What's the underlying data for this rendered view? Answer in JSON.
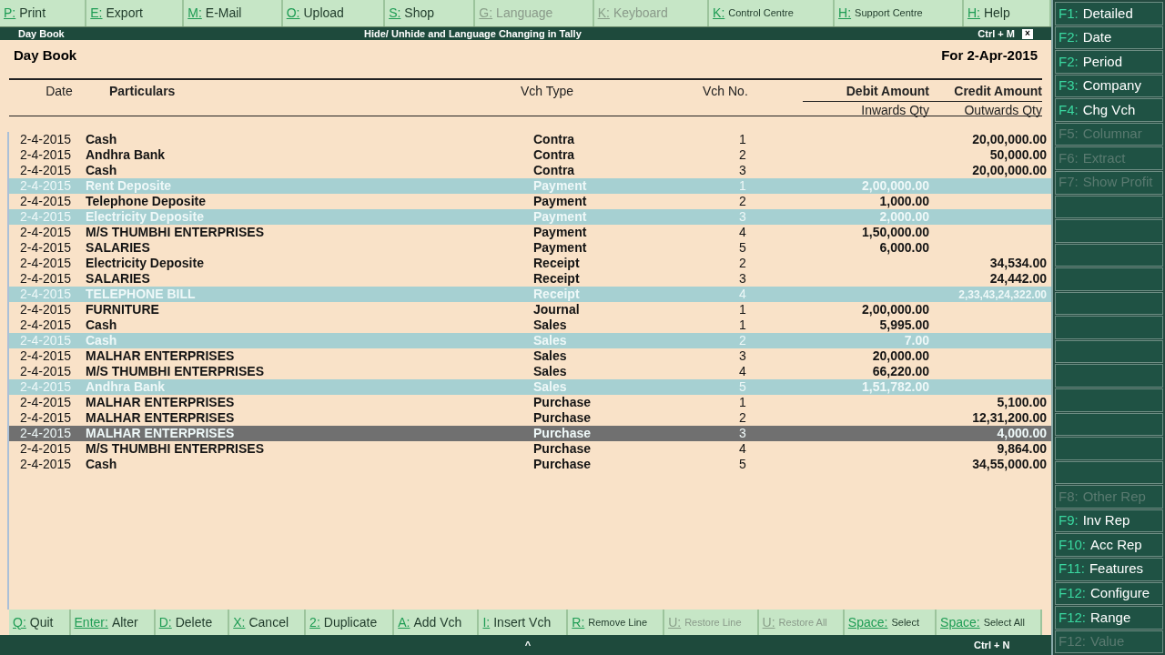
{
  "top_buttons": [
    {
      "key": "P:",
      "label": "Print",
      "disabled": false,
      "small": false
    },
    {
      "key": "E:",
      "label": "Export",
      "disabled": false,
      "small": false
    },
    {
      "key": "M:",
      "label": "E-Mail",
      "disabled": false,
      "small": false
    },
    {
      "key": "O:",
      "label": "Upload",
      "disabled": false,
      "small": false
    },
    {
      "key": "S:",
      "label": "Shop",
      "disabled": false,
      "small": false
    },
    {
      "key": "G:",
      "label": "Language",
      "disabled": true,
      "small": false
    },
    {
      "key": "K:",
      "label": "Keyboard",
      "disabled": true,
      "small": false
    },
    {
      "key": "K:",
      "label": "Control Centre",
      "disabled": false,
      "small": true
    },
    {
      "key": "H:",
      "label": "Support Centre",
      "disabled": false,
      "small": true
    },
    {
      "key": "H:",
      "label": "Help",
      "disabled": false,
      "small": false
    }
  ],
  "title_bar": {
    "left": "Day Book",
    "center": "Hide/ Unhide  and Language Changing in Tally",
    "shortcut": "Ctrl + M",
    "close": "×"
  },
  "report": {
    "title": "Day Book",
    "period": "For 2-Apr-2015"
  },
  "columns": {
    "date": "Date",
    "particulars": "Particulars",
    "vch_type": "Vch Type",
    "vch_no": "Vch No.",
    "debit": "Debit Amount",
    "credit": "Credit Amount",
    "inwards": "Inwards Qty",
    "outwards": "Outwards Qty"
  },
  "rows": [
    {
      "date": "2-4-2015",
      "particulars": "Cash",
      "vch_type": "Contra",
      "vch_no": "1",
      "debit": "",
      "credit": "20,00,000.00",
      "hidden": false,
      "selected": false
    },
    {
      "date": "2-4-2015",
      "particulars": "Andhra Bank",
      "vch_type": "Contra",
      "vch_no": "2",
      "debit": "",
      "credit": "50,000.00",
      "hidden": false,
      "selected": false
    },
    {
      "date": "2-4-2015",
      "particulars": "Cash",
      "vch_type": "Contra",
      "vch_no": "3",
      "debit": "",
      "credit": "20,00,000.00",
      "hidden": false,
      "selected": false
    },
    {
      "date": "2-4-2015",
      "particulars": "Rent Deposite",
      "vch_type": "Payment",
      "vch_no": "1",
      "debit": "2,00,000.00",
      "credit": "",
      "hidden": true,
      "selected": false
    },
    {
      "date": "2-4-2015",
      "particulars": "Telephone Deposite",
      "vch_type": "Payment",
      "vch_no": "2",
      "debit": "1,000.00",
      "credit": "",
      "hidden": false,
      "selected": false
    },
    {
      "date": "2-4-2015",
      "particulars": "Electricity Deposite",
      "vch_type": "Payment",
      "vch_no": "3",
      "debit": "2,000.00",
      "credit": "",
      "hidden": true,
      "selected": false
    },
    {
      "date": "2-4-2015",
      "particulars": "M/S THUMBHI ENTERPRISES",
      "vch_type": "Payment",
      "vch_no": "4",
      "debit": "1,50,000.00",
      "credit": "",
      "hidden": false,
      "selected": false
    },
    {
      "date": "2-4-2015",
      "particulars": "SALARIES",
      "vch_type": "Payment",
      "vch_no": "5",
      "debit": "6,000.00",
      "credit": "",
      "hidden": false,
      "selected": false
    },
    {
      "date": "2-4-2015",
      "particulars": "Electricity Deposite",
      "vch_type": "Receipt",
      "vch_no": "2",
      "debit": "",
      "credit": "34,534.00",
      "hidden": false,
      "selected": false
    },
    {
      "date": "2-4-2015",
      "particulars": "SALARIES",
      "vch_type": "Receipt",
      "vch_no": "3",
      "debit": "",
      "credit": "24,442.00",
      "hidden": false,
      "selected": false
    },
    {
      "date": "2-4-2015",
      "particulars": "TELEPHONE BILL",
      "vch_type": "Receipt",
      "vch_no": "4",
      "debit": "",
      "credit": "2,33,43,24,322.00",
      "hidden": true,
      "selected": false
    },
    {
      "date": "2-4-2015",
      "particulars": "FURNITURE",
      "vch_type": "Journal",
      "vch_no": "1",
      "debit": "2,00,000.00",
      "credit": "",
      "hidden": false,
      "selected": false
    },
    {
      "date": "2-4-2015",
      "particulars": "Cash",
      "vch_type": "Sales",
      "vch_no": "1",
      "debit": "5,995.00",
      "credit": "",
      "hidden": false,
      "selected": false
    },
    {
      "date": "2-4-2015",
      "particulars": "Cash",
      "vch_type": "Sales",
      "vch_no": "2",
      "debit": "7.00",
      "credit": "",
      "hidden": true,
      "selected": false
    },
    {
      "date": "2-4-2015",
      "particulars": "MALHAR ENTERPRISES",
      "vch_type": "Sales",
      "vch_no": "3",
      "debit": "20,000.00",
      "credit": "",
      "hidden": false,
      "selected": false
    },
    {
      "date": "2-4-2015",
      "particulars": "M/S THUMBHI ENTERPRISES",
      "vch_type": "Sales",
      "vch_no": "4",
      "debit": "66,220.00",
      "credit": "",
      "hidden": false,
      "selected": false
    },
    {
      "date": "2-4-2015",
      "particulars": "Andhra Bank",
      "vch_type": "Sales",
      "vch_no": "5",
      "debit": "1,51,782.00",
      "credit": "",
      "hidden": true,
      "selected": false
    },
    {
      "date": "2-4-2015",
      "particulars": "MALHAR ENTERPRISES",
      "vch_type": "Purchase",
      "vch_no": "1",
      "debit": "",
      "credit": "5,100.00",
      "hidden": false,
      "selected": false
    },
    {
      "date": "2-4-2015",
      "particulars": "MALHAR ENTERPRISES",
      "vch_type": "Purchase",
      "vch_no": "2",
      "debit": "",
      "credit": "12,31,200.00",
      "hidden": false,
      "selected": false
    },
    {
      "date": "2-4-2015",
      "particulars": "MALHAR ENTERPRISES",
      "vch_type": "Purchase",
      "vch_no": "3",
      "debit": "",
      "credit": "4,000.00",
      "hidden": false,
      "selected": true
    },
    {
      "date": "2-4-2015",
      "particulars": "M/S THUMBHI ENTERPRISES",
      "vch_type": "Purchase",
      "vch_no": "4",
      "debit": "",
      "credit": "9,864.00",
      "hidden": false,
      "selected": false
    },
    {
      "date": "2-4-2015",
      "particulars": "Cash",
      "vch_type": "Purchase",
      "vch_no": "5",
      "debit": "",
      "credit": "34,55,000.00",
      "hidden": false,
      "selected": false
    }
  ],
  "bottom_buttons": [
    {
      "key": "Q:",
      "label": "Quit",
      "disabled": false,
      "small": false
    },
    {
      "key": "Enter:",
      "label": "Alter",
      "disabled": false,
      "small": false
    },
    {
      "key": "D:",
      "label": "Delete",
      "disabled": false,
      "small": false
    },
    {
      "key": "X:",
      "label": "Cancel",
      "disabled": false,
      "small": false
    },
    {
      "key": "2:",
      "label": "Duplicate",
      "disabled": false,
      "small": false
    },
    {
      "key": "A:",
      "label": "Add Vch",
      "disabled": false,
      "small": false
    },
    {
      "key": "I:",
      "label": "Insert Vch",
      "disabled": false,
      "small": false
    },
    {
      "key": "R:",
      "label": "Remove Line",
      "disabled": false,
      "small": true
    },
    {
      "key": "U:",
      "label": "Restore Line",
      "disabled": true,
      "small": true
    },
    {
      "key": "U:",
      "label": "Restore All",
      "disabled": true,
      "small": true
    },
    {
      "key": "Space:",
      "label": "Select",
      "disabled": false,
      "small": true
    },
    {
      "key": "Space:",
      "label": "Select All",
      "disabled": false,
      "small": true
    }
  ],
  "bottom_strip": {
    "caret": "^",
    "shortcut": "Ctrl + N"
  },
  "sidebar": [
    {
      "kind": "key",
      "key": "F1:",
      "label": "Detailed",
      "disabled": false
    },
    {
      "kind": "key",
      "key": "F2:",
      "label": "Date",
      "disabled": false
    },
    {
      "kind": "key",
      "key": "F2:",
      "label": "Period",
      "disabled": false
    },
    {
      "kind": "key",
      "key": "F3:",
      "label": "Company",
      "disabled": false
    },
    {
      "kind": "key",
      "key": "F4:",
      "label": "Chg Vch",
      "disabled": false
    },
    {
      "kind": "key",
      "key": "F5:",
      "label": "Columnar",
      "disabled": true
    },
    {
      "kind": "key",
      "key": "F6:",
      "label": "Extract",
      "disabled": true
    },
    {
      "kind": "key",
      "key": "F7:",
      "label": "Show Profit",
      "disabled": true
    },
    {
      "kind": "blank"
    },
    {
      "kind": "blank"
    },
    {
      "kind": "blank"
    },
    {
      "kind": "blank"
    },
    {
      "kind": "blank"
    },
    {
      "kind": "blank"
    },
    {
      "kind": "blank"
    },
    {
      "kind": "blank"
    },
    {
      "kind": "blank"
    },
    {
      "kind": "blank"
    },
    {
      "kind": "blank"
    },
    {
      "kind": "blank"
    },
    {
      "kind": "key",
      "key": "F8:",
      "label": "Other Rep",
      "disabled": true
    },
    {
      "kind": "key",
      "key": "F9:",
      "label": "Inv Rep",
      "disabled": false
    },
    {
      "kind": "key",
      "key": "F10:",
      "label": "Acc Rep",
      "disabled": false
    },
    {
      "kind": "key",
      "key": "F11:",
      "label": "Features",
      "disabled": false
    },
    {
      "kind": "key",
      "key": "F12:",
      "label": "Configure",
      "disabled": false
    },
    {
      "kind": "key",
      "key": "F12:",
      "label": "Range",
      "disabled": false
    },
    {
      "kind": "key",
      "key": "F12:",
      "label": "Value",
      "disabled": true
    }
  ]
}
